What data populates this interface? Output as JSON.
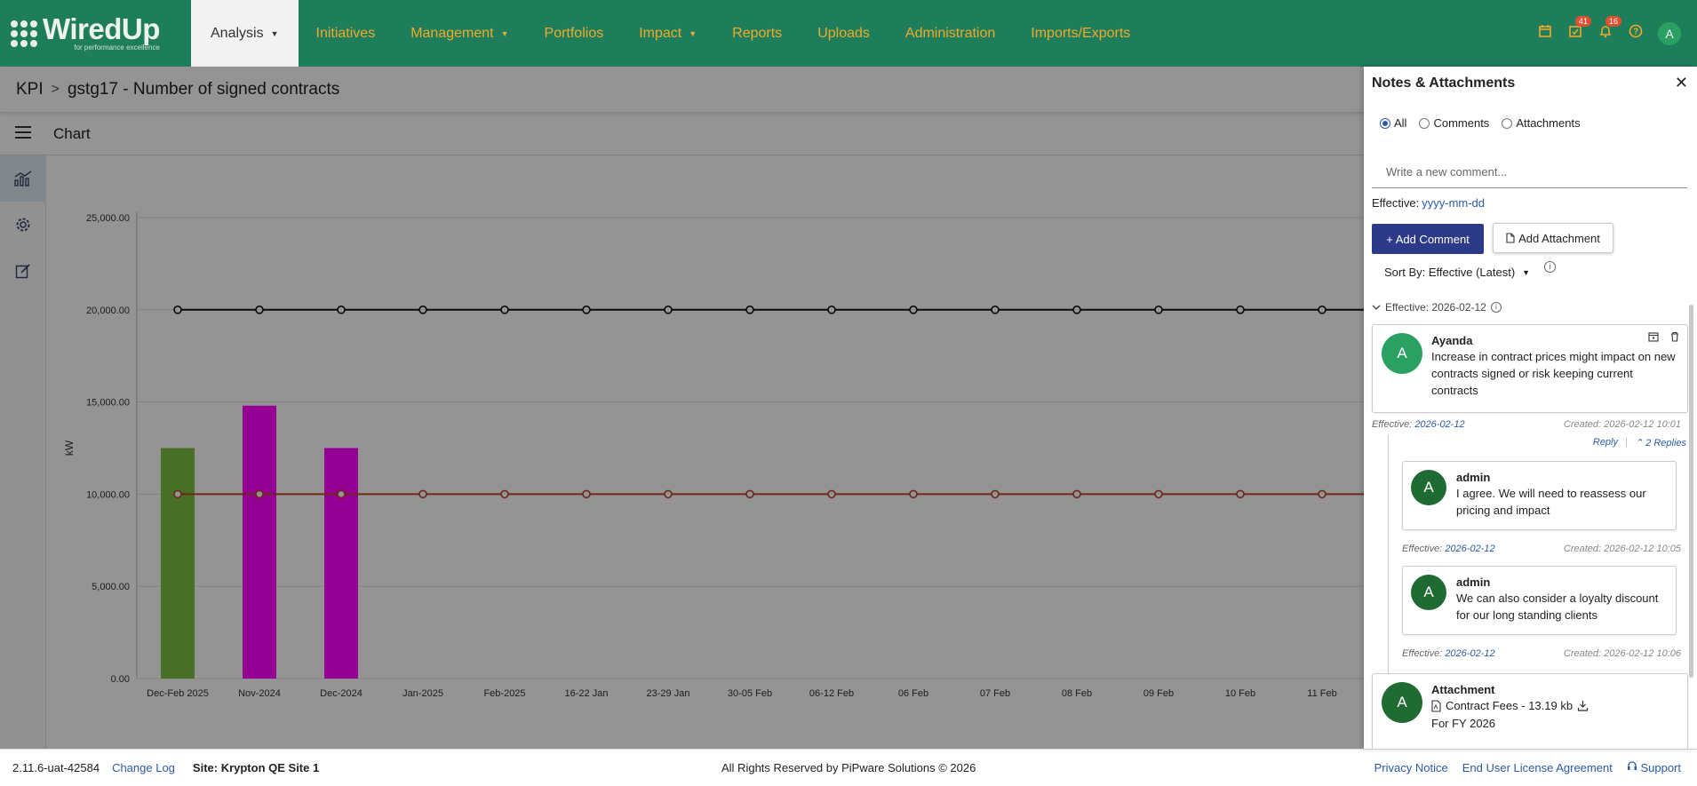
{
  "brand": {
    "name": "WiredUp",
    "tagline": "for performance excellence"
  },
  "nav": {
    "items": [
      {
        "label": "Analysis",
        "caret": "▼",
        "active": true
      },
      {
        "label": "Initiatives"
      },
      {
        "label": "Management",
        "caret": "▼"
      },
      {
        "label": "Portfolios"
      },
      {
        "label": "Impact",
        "caret": "▼"
      },
      {
        "label": "Reports"
      },
      {
        "label": "Uploads"
      },
      {
        "label": "Administration"
      },
      {
        "label": "Imports/Exports"
      }
    ],
    "icons": [
      {
        "name": "calendar-icon",
        "glyph": "📅"
      },
      {
        "name": "tasks-icon",
        "glyph": "☑",
        "badge": "41"
      },
      {
        "name": "bell-icon",
        "glyph": "🔔",
        "badge": "16"
      },
      {
        "name": "help-icon",
        "glyph": "?"
      }
    ],
    "avatar": "A"
  },
  "breadcrumb": {
    "root": "KPI",
    "separator": ">",
    "current": "gstg17 - Number of signed contracts"
  },
  "chart_header": {
    "title": "Chart"
  },
  "chart_data": {
    "type": "bar",
    "ylabel": "kW",
    "ylim": [
      0,
      25000
    ],
    "yticks": [
      "25,000.00",
      "20,000.00",
      "15,000.00",
      "10,000.00",
      "5,000.00",
      "0.00"
    ],
    "categories": [
      "Dec-Feb 2025",
      "Nov-2024",
      "Dec-2024",
      "Jan-2025",
      "Feb-2025",
      "16-22 Jan",
      "23-29 Jan",
      "30-05 Feb",
      "06-12 Feb",
      "06 Feb",
      "07 Feb",
      "08 Feb",
      "09 Feb",
      "10 Feb",
      "11 Feb"
    ],
    "series": [
      {
        "type": "bar",
        "values": [
          12500,
          14800,
          12500,
          null,
          null,
          null,
          null,
          null,
          null,
          null,
          null,
          null,
          null,
          null,
          null
        ],
        "colors": [
          "#7bc043",
          "#ff00ff",
          "#ff00ff"
        ]
      },
      {
        "type": "line",
        "color": "#111111",
        "values": [
          20000,
          20000,
          20000,
          20000,
          20000,
          20000,
          20000,
          20000,
          20000,
          20000,
          20000,
          20000,
          20000,
          20000,
          20000
        ]
      },
      {
        "type": "line",
        "color": "#c0442a",
        "values": [
          10000,
          10000,
          10000,
          10000,
          10000,
          10000,
          10000,
          10000,
          10000,
          10000,
          10000,
          10000,
          10000,
          10000,
          10000
        ]
      }
    ],
    "grid": true
  },
  "footer": {
    "version": "2.11.6-uat-42584",
    "changelog": "Change Log",
    "site": "Site: Krypton QE Site 1",
    "copyright": "All Rights Reserved by PiPware Solutions © 2026",
    "privacy": "Privacy Notice",
    "eula": "End User License Agreement",
    "support": "Support"
  },
  "panel": {
    "title": "Notes & Attachments",
    "close": "✕",
    "filters": [
      {
        "label": "All",
        "checked": true
      },
      {
        "label": "Comments",
        "checked": false
      },
      {
        "label": "Attachments",
        "checked": false
      }
    ],
    "comment_placeholder": "Write a new comment...",
    "effective_label": "Effective:",
    "effective_value": "yyyy-mm-dd",
    "add_comment": "+ Add Comment",
    "add_attachment": "Add Attachment",
    "sort_label": "Sort By: Effective (Latest)",
    "group": {
      "label": "Effective: 2026-02-12"
    },
    "entries": [
      {
        "avatar": "A",
        "author": "Ayanda",
        "text": "Increase in contract prices might impact on new contracts signed or risk keeping current contracts",
        "effective_label": "Effective:",
        "effective": "2026-02-12",
        "created": "Created: 2026-02-12 10:01",
        "reply": "Reply",
        "replies": "2 Replies"
      },
      {
        "avatar": "A",
        "author": "admin",
        "text": "I agree. We will need to reassess our pricing and impact",
        "effective_label": "Effective:",
        "effective": "2026-02-12",
        "created": "Created: 2026-02-12 10:05"
      },
      {
        "avatar": "A",
        "author": "admin",
        "text": "We can also consider a loyalty discount for our long standing clients",
        "effective_label": "Effective:",
        "effective": "2026-02-12",
        "created": "Created: 2026-02-12 10:06"
      },
      {
        "avatar": "A",
        "author": "Attachment",
        "file": "Contract Fees - 13.19 kb",
        "text": "For FY 2026"
      }
    ]
  }
}
